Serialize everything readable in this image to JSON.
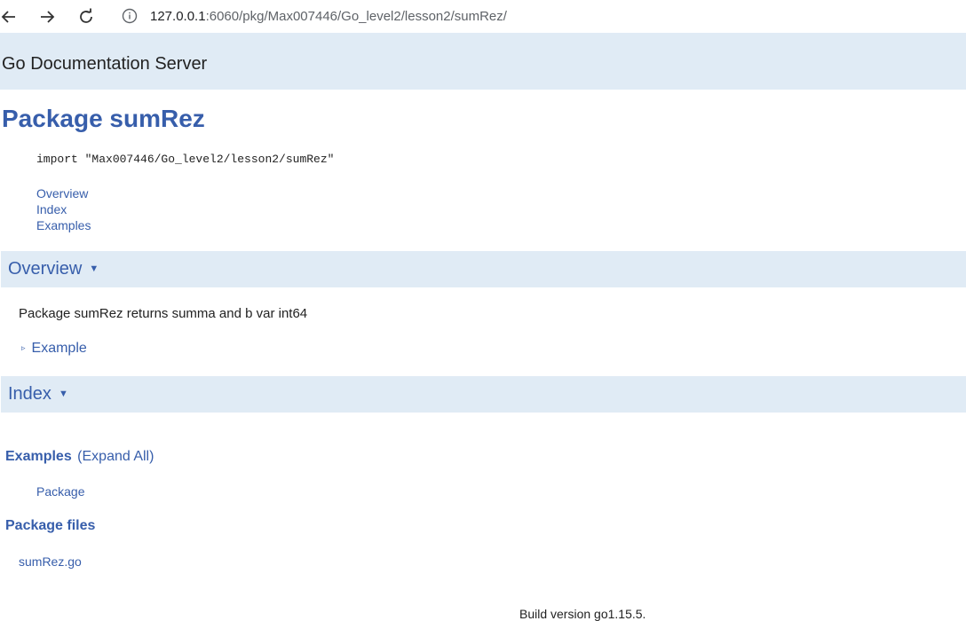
{
  "browser": {
    "url_host": "127.0.0.1",
    "url_rest": ":6060/pkg/Max007446/Go_level2/lesson2/sumRez/",
    "icons": [
      "back-arrow-icon",
      "forward-arrow-icon",
      "reload-icon",
      "info-icon"
    ]
  },
  "topbar": {
    "title": "Go Documentation Server"
  },
  "page": {
    "title": "Package sumRez",
    "import_line": "import \"Max007446/Go_level2/lesson2/sumRez\"",
    "toc": {
      "overview": "Overview",
      "index": "Index",
      "examples": "Examples"
    }
  },
  "overview": {
    "header": "Overview",
    "text": "Package sumRez returns summa and b var int64",
    "example_toggle": "Example"
  },
  "index": {
    "header": "Index",
    "examples_heading": "Examples",
    "expand_all": "(Expand All)",
    "examples_list": [
      "Package"
    ],
    "package_files_heading": "Package files",
    "files": [
      "sumRez.go"
    ]
  },
  "footer": {
    "build_version": "Build version go1.15.5."
  },
  "colors": {
    "link": "#375eab",
    "header_bg": "#e0ebf5",
    "text": "#222222"
  }
}
